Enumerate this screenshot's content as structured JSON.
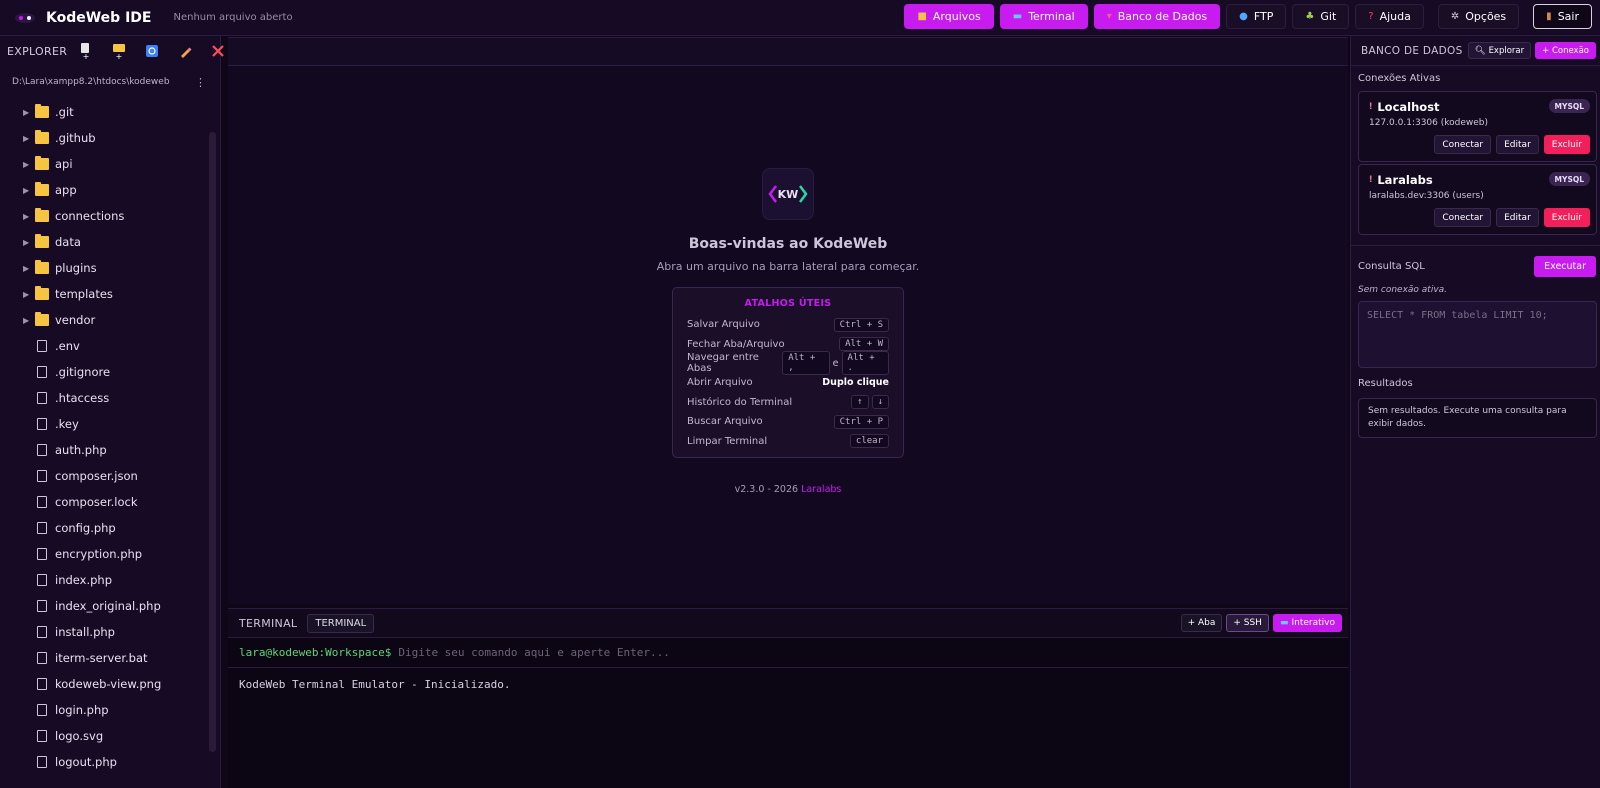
{
  "header": {
    "app_title": "KodeWeb IDE",
    "file_status": "Nenhum arquivo aberto",
    "nav": {
      "arquivos": "Arquivos",
      "terminal": "Terminal",
      "banco": "Banco de Dados",
      "ftp": "FTP",
      "git": "Git",
      "ajuda": "Ajuda",
      "opcoes": "Opções",
      "sair": "Sair"
    }
  },
  "sidebar": {
    "title": "EXPLORER",
    "path": "D:\\Lara\\xampp8.2\\htdocs\\kodeweb",
    "folders": [
      ".git",
      ".github",
      "api",
      "app",
      "connections",
      "data",
      "plugins",
      "templates",
      "vendor"
    ],
    "files": [
      ".env",
      ".gitignore",
      ".htaccess",
      ".key",
      "auth.php",
      "composer.json",
      "composer.lock",
      "config.php",
      "encryption.php",
      "index.php",
      "index_original.php",
      "install.php",
      "iterm-server.bat",
      "kodeweb-view.png",
      "login.php",
      "logo.svg",
      "logout.php"
    ]
  },
  "welcome": {
    "logo_text": "KW",
    "title": "Boas-vindas ao KodeWeb",
    "subtitle": "Abra um arquivo na barra lateral para começar.",
    "shortcuts_title": "ATALHOS ÚTEIS",
    "shortcuts": [
      {
        "label": "Salvar Arquivo",
        "keys": [
          "Ctrl + S"
        ]
      },
      {
        "label": "Fechar Aba/Arquivo",
        "keys": [
          "Alt + W"
        ]
      },
      {
        "label": "Navegar entre Abas",
        "keys": [
          "Alt + ,",
          "Alt + ."
        ],
        "joiner": "e"
      },
      {
        "label": "Abrir Arquivo",
        "text": "Duplo clique"
      },
      {
        "label": "Histórico do Terminal",
        "keys": [
          "↑",
          "↓"
        ]
      },
      {
        "label": "Buscar Arquivo",
        "keys": [
          "Ctrl + P"
        ]
      },
      {
        "label": "Limpar Terminal",
        "keys": [
          "clear"
        ]
      }
    ],
    "version": "v2.3.0 - 2026",
    "brand": "Laralabs"
  },
  "terminal": {
    "title": "TERMINAL",
    "tab": "TERMINAL",
    "btn_aba": "+ Aba",
    "btn_ssh": "+ SSH",
    "btn_interativo": "Interativo",
    "prompt": "lara@kodeweb:Workspace$",
    "placeholder": "Digite seu comando aqui e aperte Enter...",
    "output": "KodeWeb Terminal Emulator - Inicializado."
  },
  "database": {
    "title": "BANCO DE DADOS",
    "explorar": "Explorar",
    "nova_conexao": "+ Conexão",
    "active_label": "Conexões Ativas",
    "connections": [
      {
        "name": "Localhost",
        "host": "127.0.0.1:3306 (kodeweb)",
        "type": "MYSQL"
      },
      {
        "name": "Laralabs",
        "host": "laralabs.dev:3306 (users)",
        "type": "MYSQL"
      }
    ],
    "conectar": "Conectar",
    "editar": "Editar",
    "excluir": "Excluir",
    "sql_label": "Consulta SQL",
    "executar": "Executar",
    "no_connection": "Sem conexão ativa.",
    "sql_placeholder": "SELECT * FROM tabela LIMIT 10;",
    "results_label": "Resultados",
    "results_empty": "Sem resultados. Execute uma consulta para exibir dados."
  },
  "colors": {
    "accent": "#c71bf0",
    "danger": "#f21f5a",
    "background": "#0f0718",
    "prompt": "#5fd37a"
  }
}
